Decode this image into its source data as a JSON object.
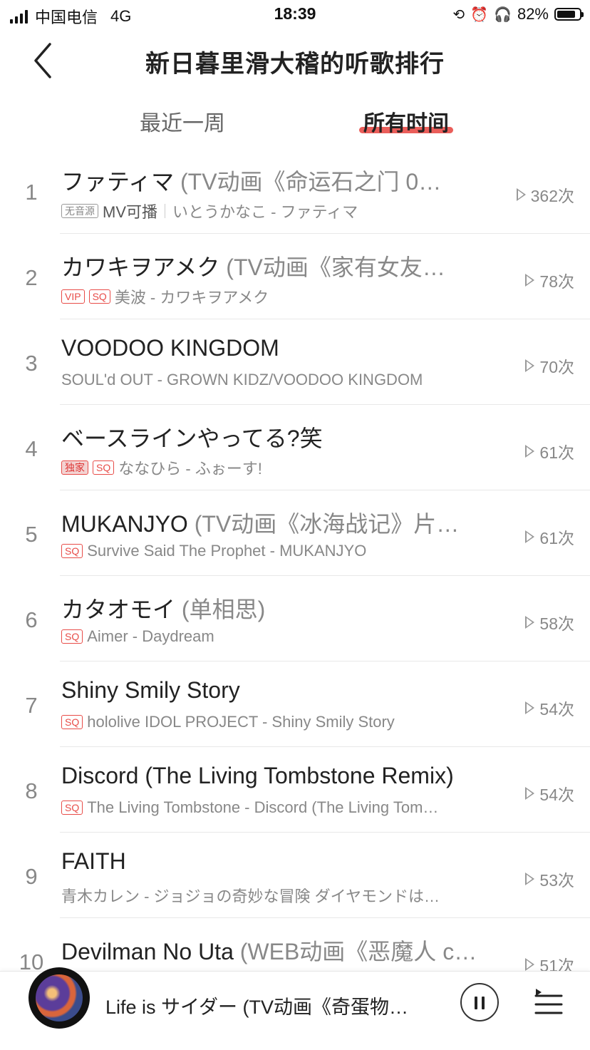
{
  "status_bar": {
    "carrier": "中国电信",
    "network": "4G",
    "time": "18:39",
    "battery": "82%",
    "battery_level": 0.82,
    "icons": [
      "cellular-signal-icon",
      "orientation-lock-icon",
      "alarm-icon",
      "headphones-icon",
      "battery-icon"
    ]
  },
  "header": {
    "title": "新日暮里滑大稽的听歌排行",
    "back_icon": "chevron-left-icon"
  },
  "tabs": [
    {
      "label": "最近一周",
      "active": false
    },
    {
      "label": "所有时间",
      "active": true
    }
  ],
  "colors": {
    "accent": "#e84c48",
    "text": "#222222",
    "muted": "#888888"
  },
  "songs": [
    {
      "rank": "1",
      "title": "ファティマ",
      "alias": "(TV动画《命运石之门 0…",
      "tags": [
        "无音源"
      ],
      "mv": "MV可播",
      "subtitle": "いとうかなこ - ファティマ",
      "plays": "362次"
    },
    {
      "rank": "2",
      "title": "カワキヲアメク",
      "alias": "(TV动画《家有女友…",
      "tags": [
        "VIP",
        "SQ"
      ],
      "subtitle": "美波 - カワキヲアメク",
      "plays": "78次"
    },
    {
      "rank": "3",
      "title": "VOODOO KINGDOM",
      "alias": "",
      "tags": [],
      "subtitle": "SOUL'd OUT - GROWN KIDZ/VOODOO KINGDOM",
      "plays": "70次"
    },
    {
      "rank": "4",
      "title": "ベースラインやってる?笑",
      "alias": "",
      "tags": [
        "独家",
        "SQ"
      ],
      "subtitle": "ななひら - ふぉーす!",
      "plays": "61次"
    },
    {
      "rank": "5",
      "title": "MUKANJYO",
      "alias": "(TV动画《冰海战记》片…",
      "tags": [
        "SQ"
      ],
      "subtitle": "Survive Said The Prophet - MUKANJYO",
      "plays": "61次"
    },
    {
      "rank": "6",
      "title": "カタオモイ",
      "alias": "(单相思)",
      "tags": [
        "SQ"
      ],
      "subtitle": "Aimer - Daydream",
      "plays": "58次"
    },
    {
      "rank": "7",
      "title": "Shiny Smily Story",
      "alias": "",
      "tags": [
        "SQ"
      ],
      "subtitle": "hololive IDOL PROJECT - Shiny Smily Story",
      "plays": "54次"
    },
    {
      "rank": "8",
      "title": "Discord (The Living Tombstone Remix)",
      "alias": "",
      "tags": [
        "SQ"
      ],
      "subtitle": "The Living Tombstone - Discord (The Living Tom…",
      "plays": "54次"
    },
    {
      "rank": "9",
      "title": "FAITH",
      "alias": "",
      "tags": [],
      "subtitle": "青木カレン - ジョジョの奇妙な冒険 ダイヤモンドは…",
      "plays": "53次"
    },
    {
      "rank": "10",
      "title": "Devilman No Uta",
      "alias": "(WEB动画《恶魔人 c…",
      "tags": [],
      "subtitle": "",
      "plays": "51次"
    }
  ],
  "mini_player": {
    "now_playing": "Life is サイダー (TV动画《奇蛋物…",
    "controls": [
      "pause-icon",
      "playlist-icon"
    ]
  }
}
